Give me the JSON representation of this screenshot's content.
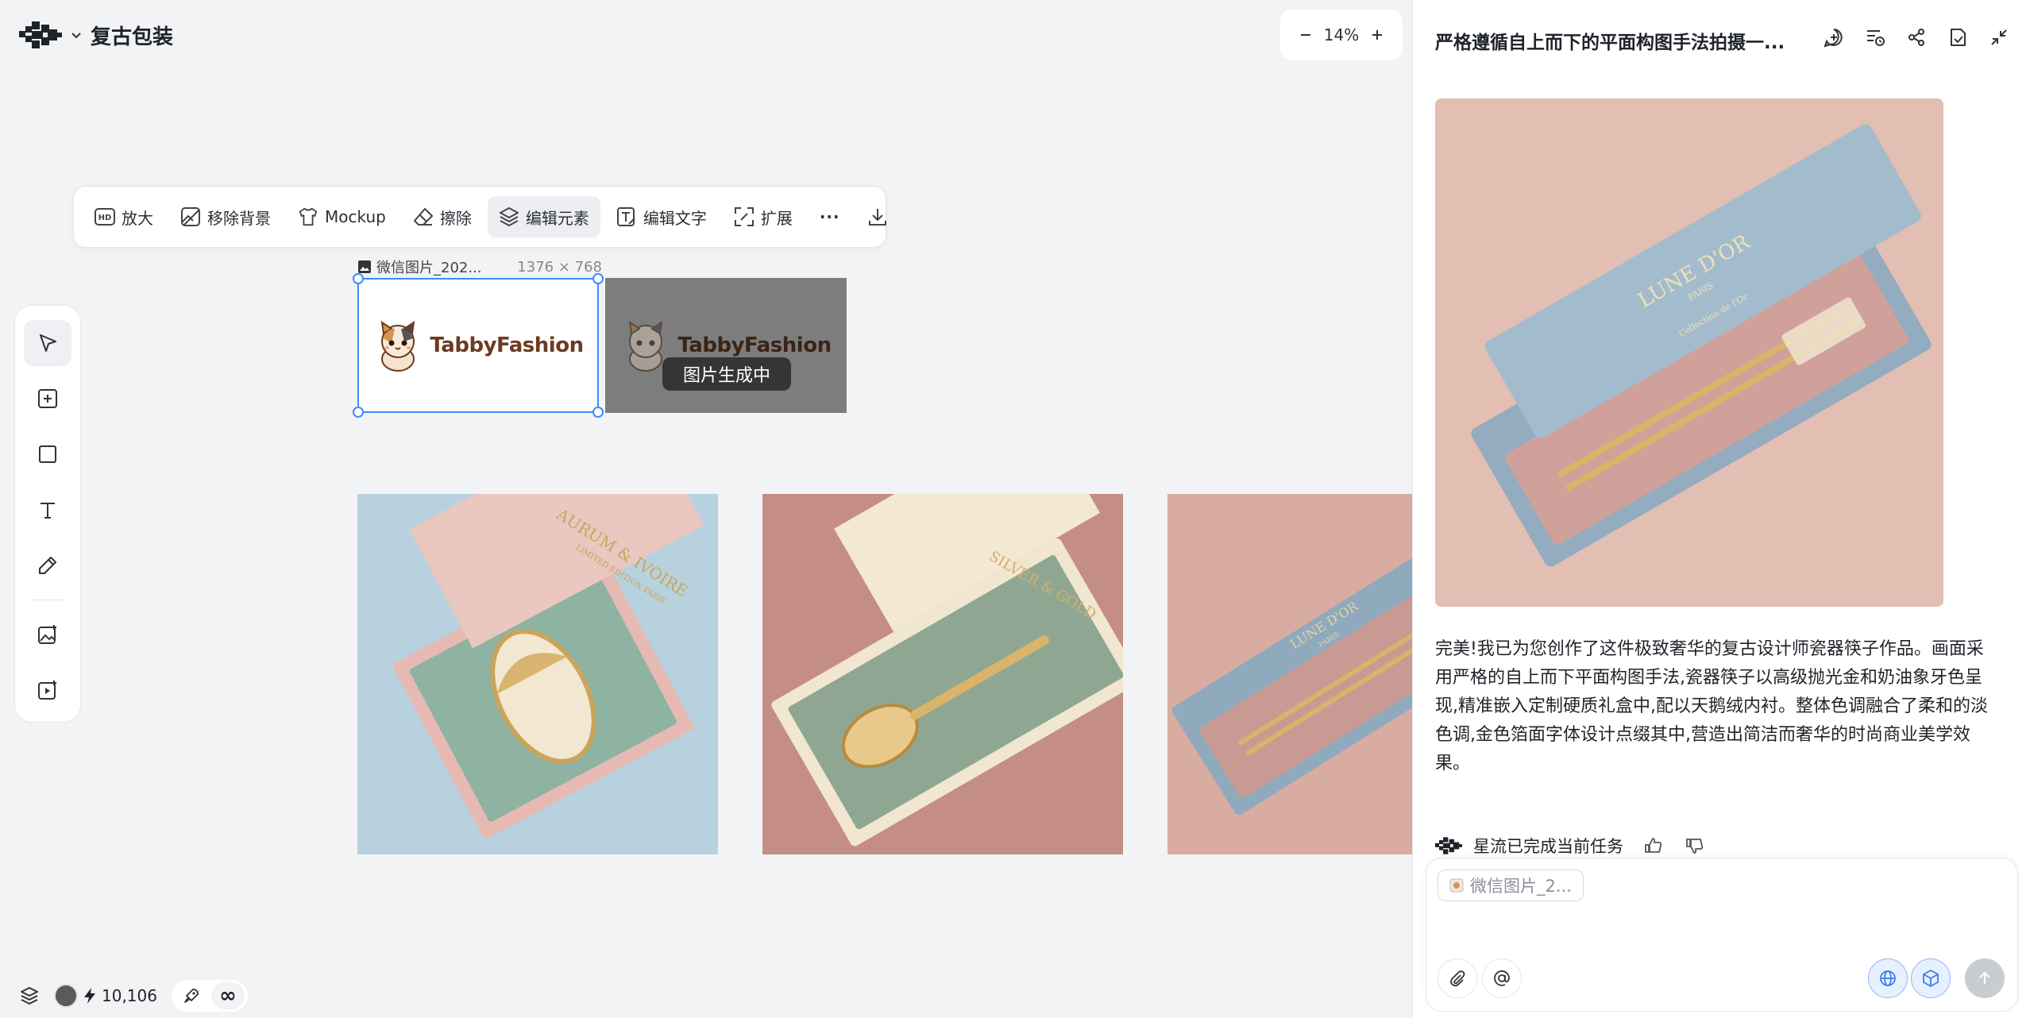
{
  "project": {
    "title": "复古包装"
  },
  "zoom": {
    "level": "14%",
    "minus": "−",
    "plus": "+"
  },
  "toolbar": {
    "items": [
      {
        "label": "放大",
        "icon": "hd-icon"
      },
      {
        "label": "移除背景",
        "icon": "remove-background-icon"
      },
      {
        "label": "Mockup",
        "icon": "tshirt-icon"
      },
      {
        "label": "擦除",
        "icon": "eraser-icon"
      },
      {
        "label": "编辑元素",
        "icon": "layers-icon",
        "active": true
      },
      {
        "label": "编辑文字",
        "icon": "edit-text-icon"
      },
      {
        "label": "扩展",
        "icon": "expand-icon"
      }
    ],
    "more_label": "···"
  },
  "canvas": {
    "selected_image": {
      "name": "微信图片_202...",
      "dimensions": "1376 × 768"
    },
    "logo_text": "TabbyFashion",
    "generating_label": "图片生成中",
    "photos": [
      {
        "brand": "AURUM & IVOIRE",
        "sub": "LIMITED EDITION PARIS"
      },
      {
        "brand": "SILVER & GOLD"
      },
      {
        "brand": "LUNE D'OR",
        "sub": "PARIS"
      }
    ]
  },
  "tools": [
    "select-tool",
    "add-frame-tool",
    "rectangle-tool",
    "text-tool",
    "pen-tool",
    "image-generate-tool",
    "video-generate-tool"
  ],
  "status": {
    "credits": "10,106",
    "infinite": "∞"
  },
  "chat": {
    "title": "严格遵循自上而下的平面构图手法拍摄一...",
    "image_brand": "LUNE D'OR",
    "image_sub": "PARIS",
    "image_tagline": "Collection de l'Or",
    "message": "完美!我已为您创作了这件极致奢华的复古设计师瓷器筷子作品。画面采用严格的自上而下平面构图手法,瓷器筷子以高级抛光金和奶油象牙色呈现,精准嵌入定制硬质礼盒中,配以天鹅绒内衬。整体色调融合了柔和的淡色调,金色箔面字体设计点缀其中,营造出简洁而奢华的时尚商业美学效果。",
    "task_status": "星流已完成当前任务",
    "attachment_chip": "微信图片_2...",
    "input_placeholder": ""
  }
}
